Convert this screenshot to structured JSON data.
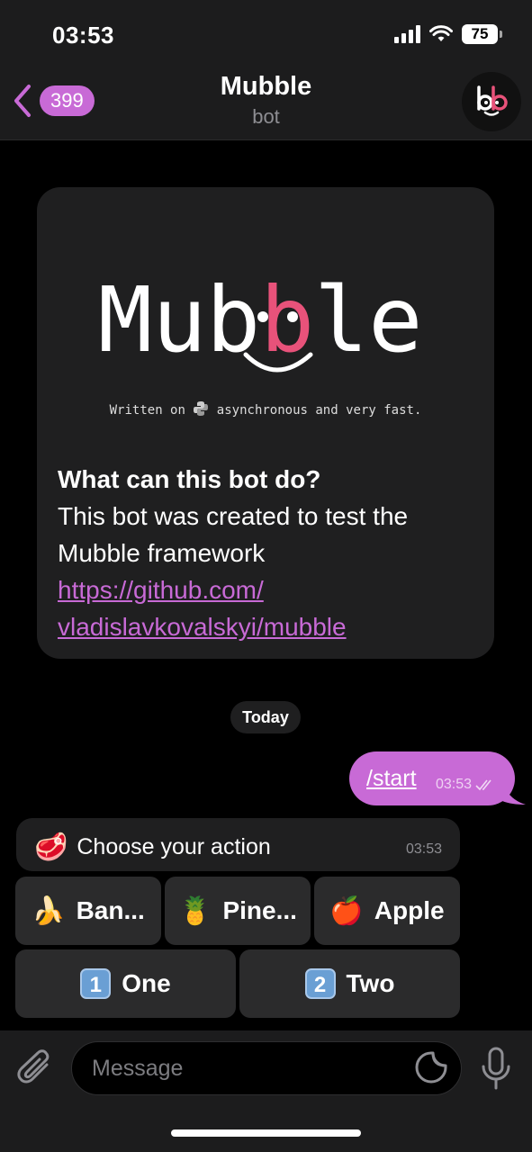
{
  "status_bar": {
    "time": "03:53",
    "battery": "75"
  },
  "header": {
    "back_count": "399",
    "title": "Mubble",
    "subtitle": "bot"
  },
  "intro": {
    "logo_text": "Mubble",
    "tagline_before": "Written on",
    "tagline_after": "asynchronous and very fast.",
    "heading": "What can this bot do?",
    "description": "This bot was created to test the Mubble framework",
    "link_line1": "https://github.com/",
    "link_line2": "vladislavkovalskyi/mubble"
  },
  "date_divider": "Today",
  "outgoing": {
    "text": "/start",
    "time": "03:53"
  },
  "incoming": {
    "text": "Choose your action",
    "time": "03:53",
    "emoji": "🥩"
  },
  "keyboard": {
    "row1": [
      {
        "emoji": "🍌",
        "label": "Ban..."
      },
      {
        "emoji": "🍍",
        "label": "Pine..."
      },
      {
        "emoji": "🍎",
        "label": "Apple"
      }
    ],
    "row2": [
      {
        "keycap": "1",
        "label": "One"
      },
      {
        "keycap": "2",
        "label": "Two"
      }
    ]
  },
  "composer": {
    "placeholder": "Message"
  },
  "colors": {
    "accent": "#c86ad6",
    "logo_pink": "#e8527a",
    "bubble_bg": "#1f1f20"
  }
}
